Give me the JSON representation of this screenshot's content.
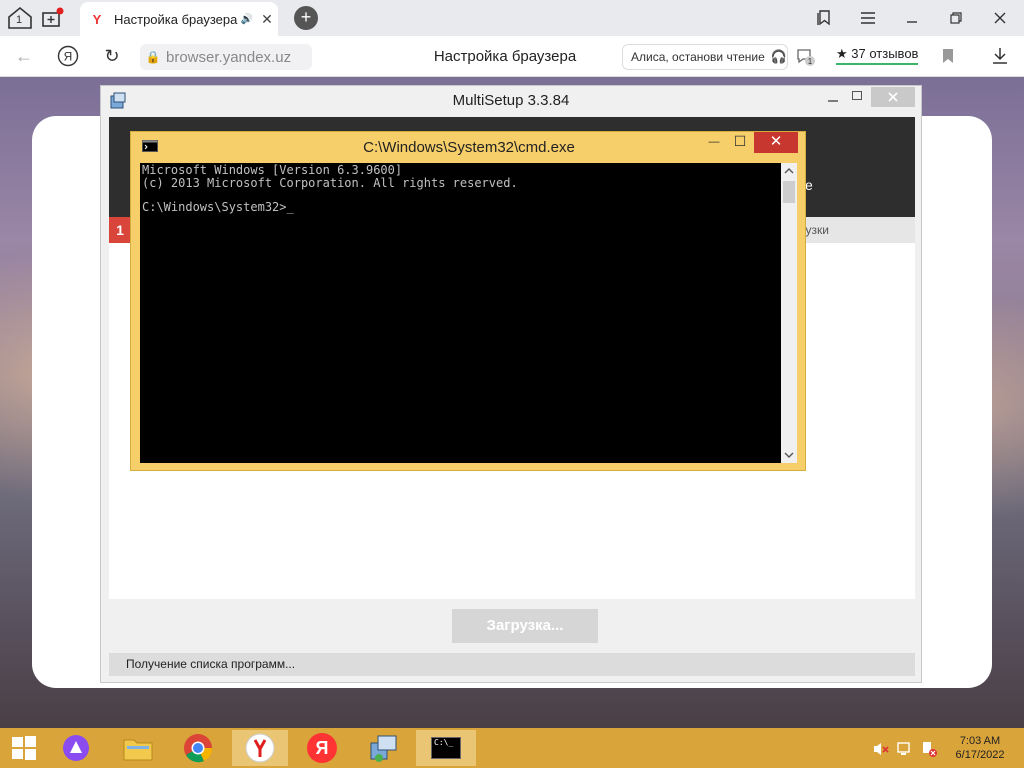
{
  "browser": {
    "tab_count": "1",
    "tab_title": "Настройка браузера",
    "url": "browser.yandex.uz",
    "page_title": "Настройка браузера",
    "alice_label": "Алиса, останови чтение",
    "reviews_label": "37 отзывов",
    "reviews_star": "★",
    "tab_close": "✕",
    "new_tab": "+"
  },
  "multisetup": {
    "title": "MultiSetup 3.3.84",
    "step_number": "1",
    "right_fragment": "е",
    "bar_fragment": "рузки",
    "download_button": "Загрузка...",
    "status": "Получение списка программ..."
  },
  "cmd": {
    "title": "C:\\Windows\\System32\\cmd.exe",
    "close": "✕",
    "minimize": "—",
    "maximize": "☐",
    "console_line1": "Microsoft Windows [Version 6.3.9600]",
    "console_line2": "(c) 2013 Microsoft Corporation. All rights reserved.",
    "console_prompt": "C:\\Windows\\System32>_"
  },
  "taskbar": {
    "time": "7:03 AM",
    "date": "6/17/2022",
    "yandex_label": "Я",
    "cmd_icon_label": "C:\\_"
  },
  "colors": {
    "taskbar": "#d9a43a",
    "cmd_frame": "#f6cf6a",
    "close_red": "#c7372f",
    "step_red": "#d9453a"
  }
}
